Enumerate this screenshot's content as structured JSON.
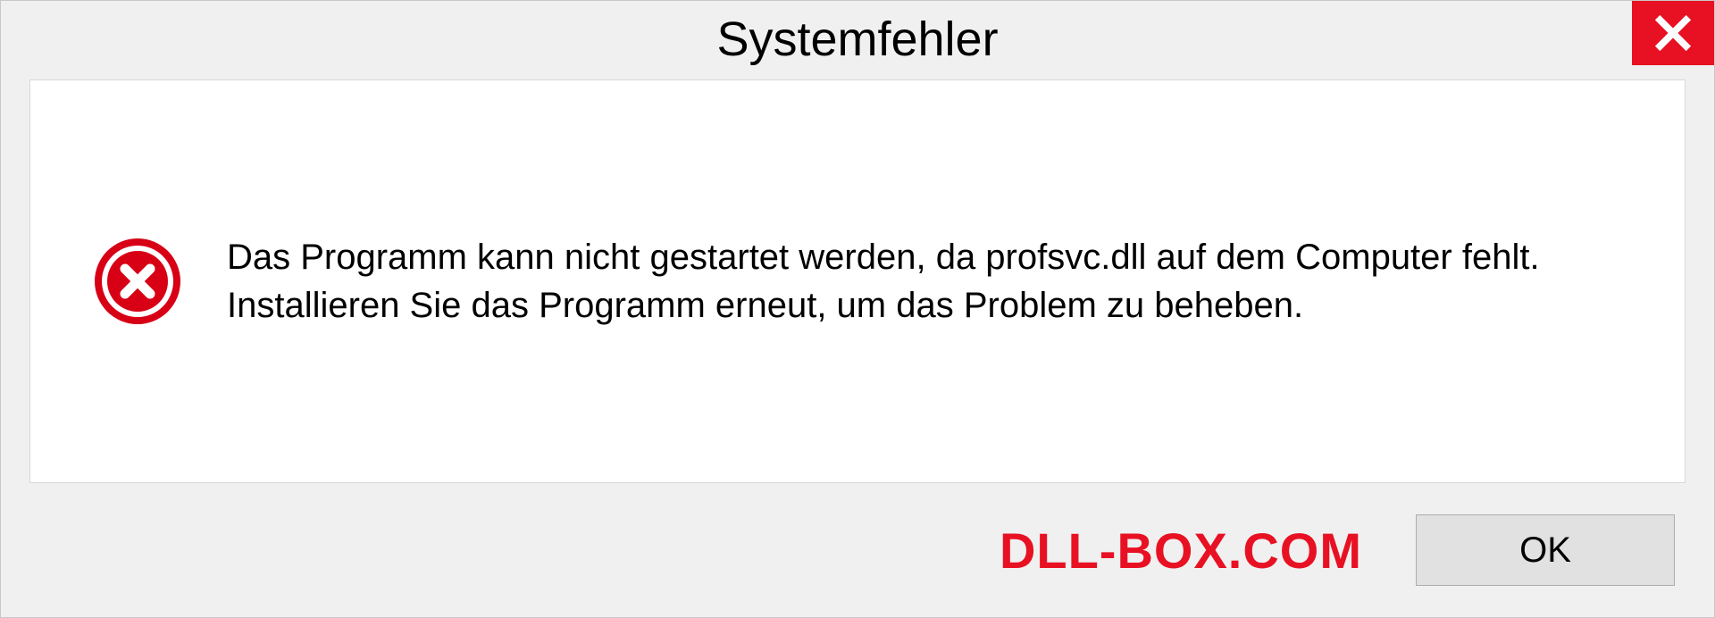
{
  "dialog": {
    "title": "Systemfehler",
    "message": "Das Programm kann nicht gestartet werden, da profsvc.dll auf dem Computer fehlt. Installieren Sie das Programm erneut, um das Problem zu beheben.",
    "ok_label": "OK"
  },
  "watermark": "DLL-BOX.COM",
  "icons": {
    "close": "close-icon",
    "error": "error-icon"
  },
  "colors": {
    "close_bg": "#e81123",
    "error_fill": "#d70015",
    "watermark": "#e81123"
  }
}
